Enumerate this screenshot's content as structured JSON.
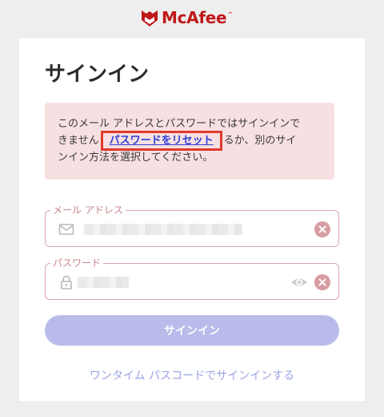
{
  "brand": {
    "name": "McAfee",
    "trademark": "™",
    "logo_icon": "mcafee-shield-m-icon",
    "color": "#c01818"
  },
  "signin": {
    "title": "サインイン",
    "error": {
      "line1": "このメール アドレスとパスワードではサインインで",
      "line2_before": "きません",
      "reset_link": "パスワードをリセット",
      "line2_after": "るか、別のサイ",
      "line3": "ンイン方法を選択してください。",
      "background": "#f7e0e1",
      "highlight_color": "#e03a2c"
    },
    "email": {
      "label": "メール アドレス",
      "icon": "mail-icon",
      "value_state": "obscured",
      "clear_icon": "clear-circle-icon"
    },
    "password": {
      "label": "パスワード",
      "icon": "lock-icon",
      "value_state": "obscured",
      "reveal_icon": "eye-icon",
      "clear_icon": "clear-circle-icon"
    },
    "submit_label": "サインイン",
    "otp_link": "ワンタイム パスコードでサインインする"
  },
  "colors": {
    "button": "#b9bcea",
    "link": "#2f3fd8",
    "field_border": "#dba7a9"
  }
}
